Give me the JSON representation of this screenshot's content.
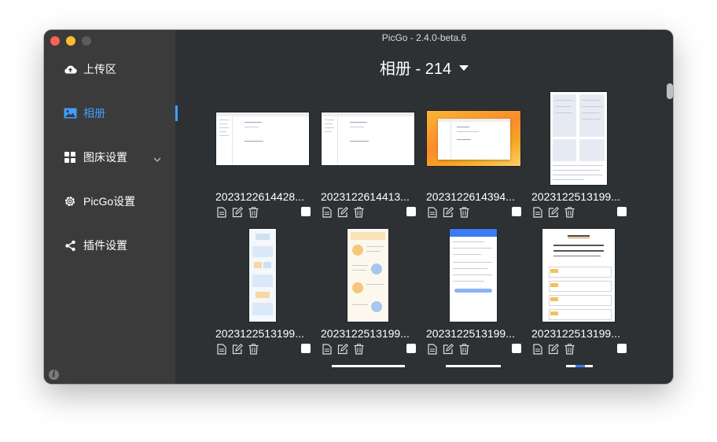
{
  "window": {
    "title": "PicGo - 2.4.0-beta.6"
  },
  "sidebar": {
    "items": [
      {
        "label": "上传区",
        "icon": "cloud-upload-icon"
      },
      {
        "label": "相册",
        "icon": "image-icon",
        "active": true
      },
      {
        "label": "图床设置",
        "icon": "grid-icon",
        "expandable": true
      },
      {
        "label": "PicGo设置",
        "icon": "gear-icon"
      },
      {
        "label": "插件设置",
        "icon": "share-icon"
      }
    ],
    "info_icon": "info-icon",
    "info_glyph": "i"
  },
  "gallery": {
    "title": "相册 - 214",
    "items": [
      {
        "name": "2023122614428...",
        "kind": "app-window"
      },
      {
        "name": "2023122614413...",
        "kind": "app-window"
      },
      {
        "name": "2023122614394...",
        "kind": "desktop"
      },
      {
        "name": "2023122513199...",
        "kind": "doc-table"
      },
      {
        "name": "2023122513199...",
        "kind": "flow-long"
      },
      {
        "name": "2023122513199...",
        "kind": "illustrated-long"
      },
      {
        "name": "2023122513199...",
        "kind": "mobile-form"
      },
      {
        "name": "2023122513199...",
        "kind": "article-steps"
      }
    ],
    "action_icons": [
      "copy-link-icon",
      "edit-icon",
      "delete-icon"
    ]
  },
  "colors": {
    "accent": "#409eff",
    "sidebar_bg": "#3b3b3b",
    "main_bg": "#2e3133",
    "text": "#ffffff"
  }
}
